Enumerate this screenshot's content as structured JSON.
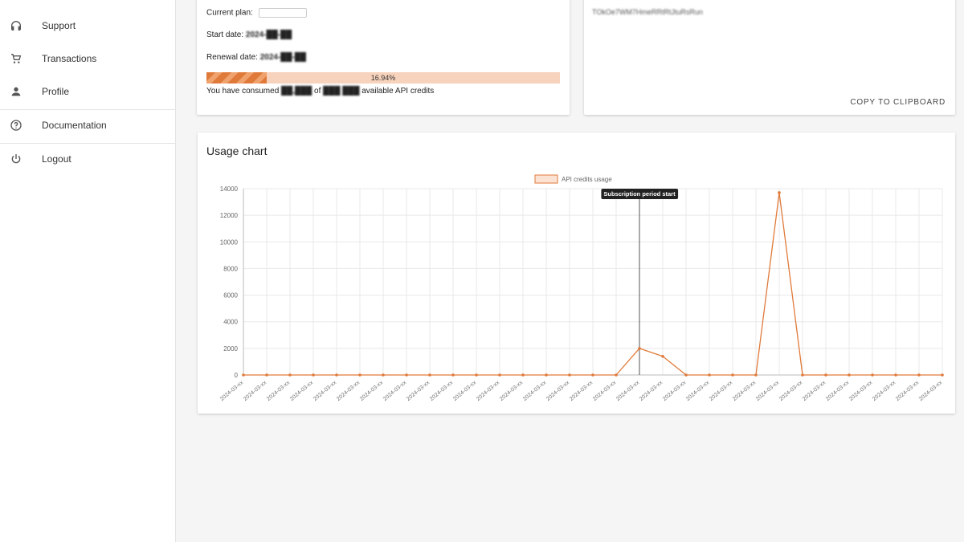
{
  "sidebar": {
    "items": [
      {
        "label": "Support",
        "icon": "headset-icon"
      },
      {
        "label": "Transactions",
        "icon": "cart-icon"
      },
      {
        "label": "Profile",
        "icon": "person-icon"
      },
      {
        "label": "Documentation",
        "icon": "help-circle-icon"
      },
      {
        "label": "Logout",
        "icon": "power-icon"
      }
    ]
  },
  "plan": {
    "current_plan_label": "Current plan:",
    "start_date_label": "Start date:",
    "start_date_value": "2024-██-██",
    "renewal_date_label": "Renewal date:",
    "renewal_date_value": "2024-██-██",
    "progress_text": "16.94%",
    "progress_value": 0.1694,
    "consumed_prefix": "You have consumed",
    "consumed_value": "██,███",
    "consumed_of": "of",
    "total_value": "███ ███",
    "consumed_suffix": "available API credits"
  },
  "api_key": {
    "value": "TOkOe7WM7HmeRRtRtJtuRsRun",
    "copy_label": "COPY TO CLIPBOARD"
  },
  "chart_title": "Usage chart",
  "colors": {
    "accent": "#e07a3a",
    "progress_track": "#f7d2bc"
  },
  "chart_data": {
    "type": "line",
    "legend": "API credits usage",
    "legend_position": "top-center",
    "annotation": "Subscription period start",
    "annotation_index": 17,
    "y_ticks": [
      0,
      2000,
      4000,
      6000,
      8000,
      10000,
      12000,
      14000
    ],
    "ylim": [
      0,
      14000
    ],
    "grid": true,
    "x_count": 31,
    "values": [
      0,
      0,
      0,
      0,
      0,
      0,
      0,
      0,
      0,
      0,
      0,
      0,
      0,
      0,
      0,
      0,
      0,
      2000,
      1400,
      0,
      0,
      0,
      0,
      13700,
      0,
      0,
      0,
      0,
      0,
      0,
      0
    ],
    "x_tick_labels": [
      "2024-03-xx",
      "2024-03-xx",
      "2024-03-xx",
      "2024-03-xx",
      "2024-03-xx",
      "2024-03-xx",
      "2024-03-xx",
      "2024-03-xx",
      "2024-03-xx",
      "2024-03-xx",
      "2024-03-xx",
      "2024-03-xx",
      "2024-03-xx",
      "2024-03-xx",
      "2024-03-xx",
      "2024-03-xx",
      "2024-03-xx",
      "2024-03-xx",
      "2024-03-xx",
      "2024-03-xx",
      "2024-03-xx",
      "2024-03-xx",
      "2024-03-xx",
      "2024-03-xx",
      "2024-03-xx",
      "2024-03-xx",
      "2024-03-xx",
      "2024-03-xx",
      "2024-03-xx",
      "2024-03-xx",
      "2024-03-xx"
    ]
  }
}
